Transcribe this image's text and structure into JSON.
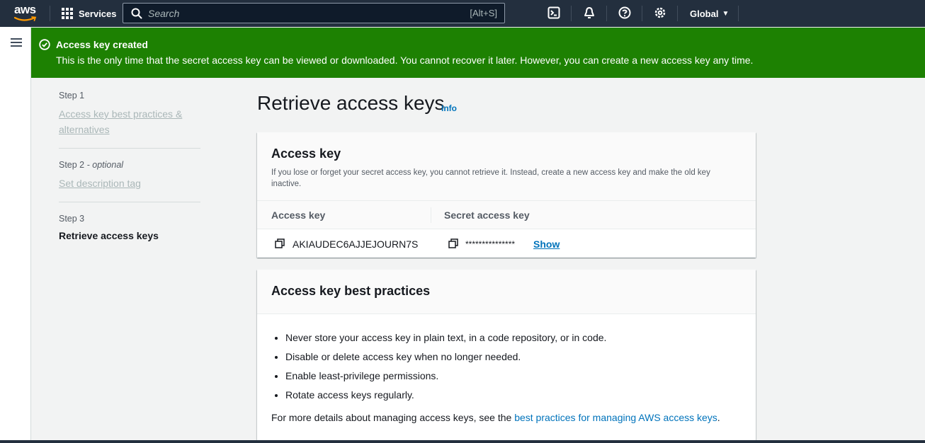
{
  "nav": {
    "logo": "aws",
    "services": "Services",
    "search_placeholder": "Search",
    "search_shortcut": "[Alt+S]",
    "region": "Global"
  },
  "flash": {
    "title": "Access key created",
    "message": "This is the only time that the secret access key can be viewed or downloaded. You cannot recover it later. However, you can create a new access key any time."
  },
  "steps": [
    {
      "label": "Step 1",
      "name": "Access key best practices & alternatives"
    },
    {
      "label": "Step 2",
      "optional": "- optional",
      "name": "Set description tag"
    },
    {
      "label": "Step 3",
      "name": "Retrieve access keys"
    }
  ],
  "page": {
    "title": "Retrieve access keys",
    "info": "Info"
  },
  "access_key_card": {
    "title": "Access key",
    "description": "If you lose or forget your secret access key, you cannot retrieve it. Instead, create a new access key and make the old key inactive.",
    "col_access_key": "Access key",
    "col_secret_key": "Secret access key",
    "access_key_value": "AKIAUDEC6AJJEJOURN7S",
    "secret_key_masked": "***************",
    "show_label": "Show"
  },
  "best_practices_card": {
    "title": "Access key best practices",
    "items": [
      "Never store your access key in plain text, in a code repository, or in code.",
      "Disable or delete access key when no longer needed.",
      "Enable least-privilege permissions.",
      "Rotate access keys regularly."
    ],
    "more_prefix": "For more details about managing access keys, see the ",
    "more_link": "best practices for managing AWS access keys",
    "more_suffix": "."
  },
  "colors": {
    "nav_bg": "#232f3e",
    "flash_success": "#1d8102",
    "link": "#0073bb"
  }
}
